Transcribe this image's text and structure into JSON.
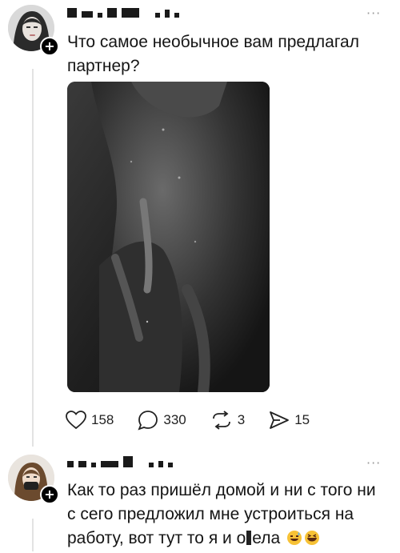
{
  "post1": {
    "avatar_icon": "user-avatar-icon",
    "text": "Что самое необычное вам предлагал партнер?",
    "photo_icon": "photo-image-icon",
    "actions": {
      "likes": "158",
      "comments": "330",
      "reposts": "3",
      "shares": "15"
    }
  },
  "post2": {
    "avatar_icon": "user-avatar-icon",
    "text_line1": "Как то раз пришёл домой и ни с того ни",
    "text_line2": "с сего предложил мне устроиться на",
    "text_line3_a": "работу, вот тут то я и о",
    "text_line3_b": "ела",
    "emoji_icons": [
      "grinning-sweat-emoji",
      "grinning-squinting-emoji"
    ]
  },
  "icons": {
    "like": "heart-icon",
    "comment": "comment-bubble-icon",
    "repost": "repost-arrows-icon",
    "share": "send-arrow-icon",
    "more": "more-dots-icon",
    "follow": "plus-icon"
  }
}
